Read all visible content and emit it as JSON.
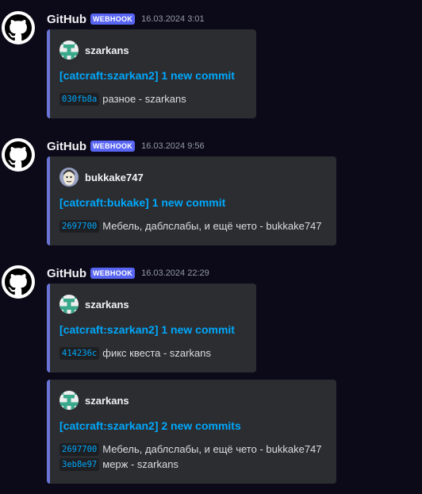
{
  "messages": [
    {
      "author": "GitHub",
      "badge": "WEBHOOK",
      "timestamp": "16.03.2024 3:01",
      "embeds": [
        {
          "author": "szarkans",
          "title": "[catcraft:szarkan2] 1 new commit",
          "commits": [
            {
              "hash": "030fb8a",
              "text": "разное - szarkans"
            }
          ]
        }
      ]
    },
    {
      "author": "GitHub",
      "badge": "WEBHOOK",
      "timestamp": "16.03.2024 9:56",
      "embeds": [
        {
          "author": "bukkake747",
          "title": "[catcraft:bukake] 1 new commit",
          "commits": [
            {
              "hash": "2697700",
              "text": "Мебель, даблслабы, и ещё чето - bukkake747"
            }
          ]
        }
      ]
    },
    {
      "author": "GitHub",
      "badge": "WEBHOOK",
      "timestamp": "16.03.2024 22:29",
      "embeds": [
        {
          "author": "szarkans",
          "title": "[catcraft:szarkan2] 1 new commit",
          "commits": [
            {
              "hash": "414236c",
              "text": "фикс квеста - szarkans"
            }
          ]
        },
        {
          "author": "szarkans",
          "title": "[catcraft:szarkan2] 2 new commits",
          "commits": [
            {
              "hash": "2697700",
              "text": "Мебель, даблслабы, и ещё чето - bukkake747"
            },
            {
              "hash": "3eb8e97",
              "text": "мерж - szarkans"
            }
          ]
        }
      ]
    }
  ],
  "colors": {
    "background": "#0c0a18",
    "embed_bg": "#2b2d31",
    "embed_border": "#6a73d6",
    "link": "#00a8fc",
    "badge": "#5865f2",
    "szarkans_avatar": "#3aa88a"
  }
}
